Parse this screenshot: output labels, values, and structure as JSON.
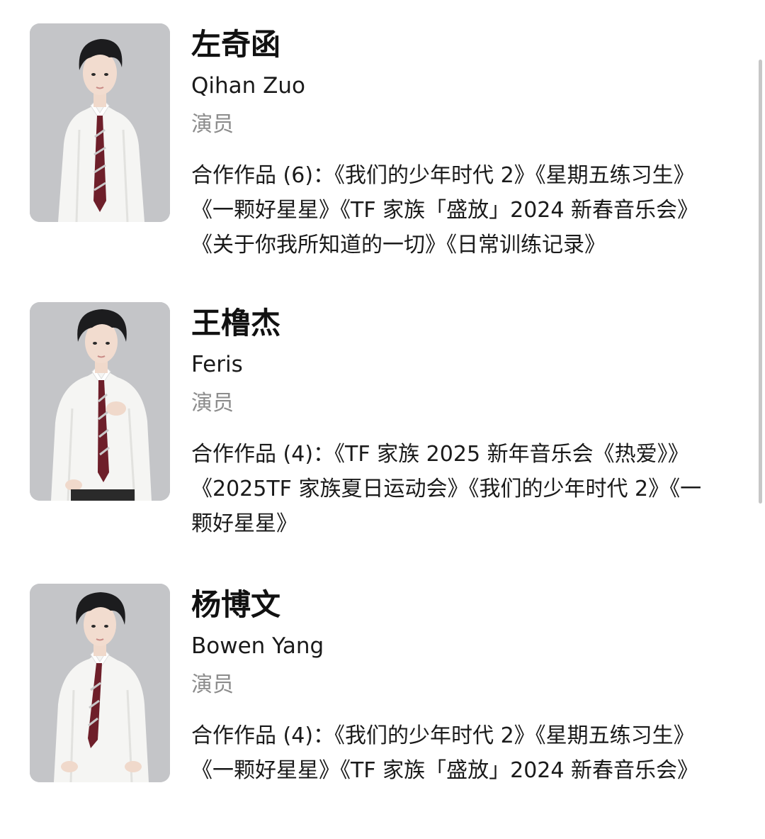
{
  "actors": [
    {
      "name": "左奇函",
      "en_name": "Qihan Zuo",
      "role": "演员",
      "works_label": "合作作品 (6)：",
      "works": "《我们的少年时代 2》《星期五练习生》《一颗好星星》《TF 家族「盛放」2024 新春音乐会》《关于你我所知道的一切》《日常训练记录》",
      "photo_icon": "person-portrait"
    },
    {
      "name": "王橹杰",
      "en_name": "Feris",
      "role": "演员",
      "works_label": "合作作品 (4)：",
      "works": "《TF 家族 2025 新年音乐会《热爱》》《2025TF 家族夏日运动会》《我们的少年时代 2》《一颗好星星》",
      "photo_icon": "person-portrait"
    },
    {
      "name": "杨博文",
      "en_name": "Bowen Yang",
      "role": "演员",
      "works_label": "合作作品 (4)：",
      "works": "《我们的少年时代 2》《星期五练习生》《一颗好星星》《TF 家族「盛放」2024 新春音乐会》",
      "photo_icon": "person-portrait"
    }
  ],
  "colors": {
    "background": "#ffffff",
    "name": "#111111",
    "role": "#8c8c8c",
    "shirt": "#f5f5f3",
    "tie": "#6e1f2a",
    "hair": "#1c1c1e",
    "photo_bg": "#c4c5c8"
  }
}
